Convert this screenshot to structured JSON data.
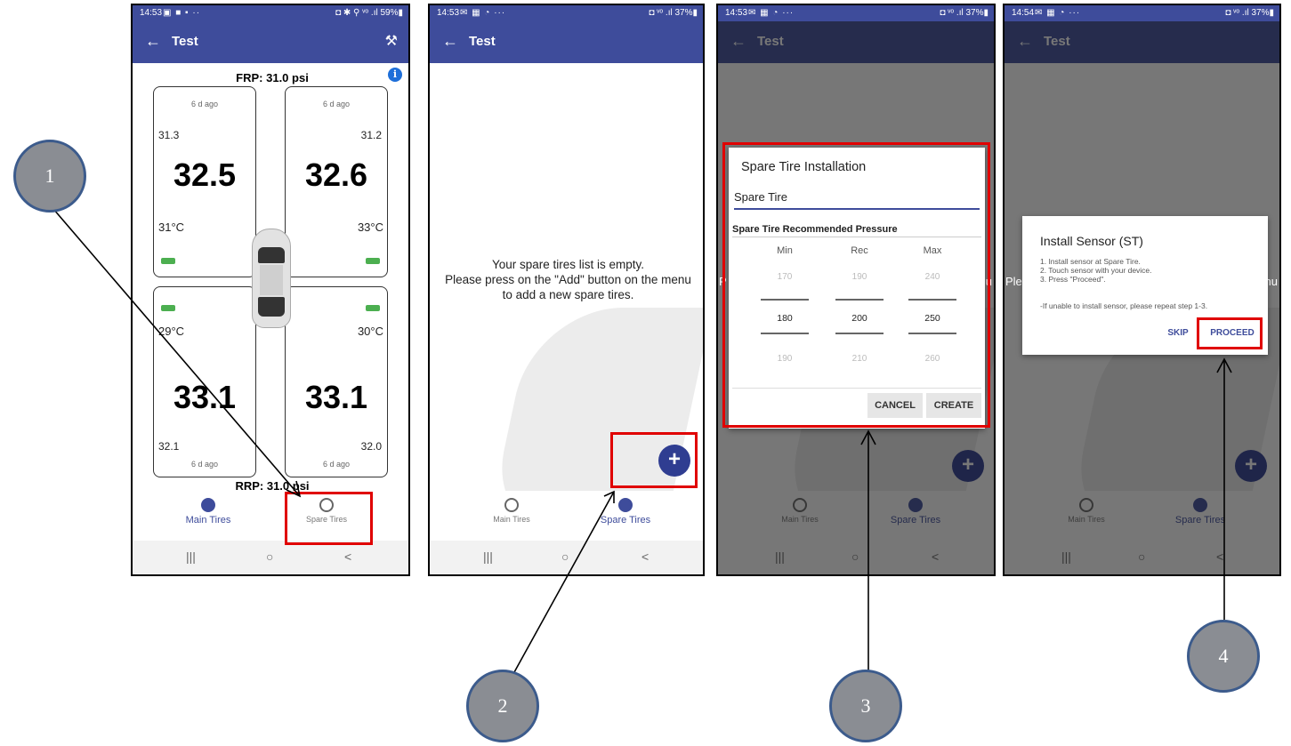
{
  "status": {
    "p1": {
      "time": "14:53",
      "icons": "▣ ■ ▪ ··",
      "right": "◘ ✱ ⚲ ᵛᵒ .ıl 59%▮"
    },
    "p2": {
      "time": "14:53",
      "icons": "✉ ▦ ◔ ···",
      "right": "◘ ᵛᵒ .ıl 37%▮"
    },
    "p3": {
      "time": "14:53",
      "icons": "✉ ▦ ◔ ···",
      "right": "◘ ᵛᵒ .ıl 37%▮"
    },
    "p4": {
      "time": "14:54",
      "icons": "✉ ▦ ◔ ···",
      "right": "◘ ᵛᵒ .ıl 37%▮"
    }
  },
  "appbar": {
    "back": "←",
    "title": "Test",
    "tool_icon": "wrench-icon",
    "tool_glyph": "⚒"
  },
  "main": {
    "frp": "FRP: 31.0 psi",
    "rrp": "RRP: 31.0 psi",
    "info_glyph": "i",
    "tires": {
      "fl": {
        "ago": "6 d ago",
        "cold": "31.3",
        "pressure": "32.5",
        "temp": "31°C"
      },
      "fr": {
        "ago": "6 d ago",
        "cold": "31.2",
        "pressure": "32.6",
        "temp": "33°C"
      },
      "rl": {
        "ago": "6 d ago",
        "cold": "32.1",
        "pressure": "33.1",
        "temp": "29°C"
      },
      "rr": {
        "ago": "6 d ago",
        "cold": "32.0",
        "pressure": "33.1",
        "temp": "30°C"
      }
    }
  },
  "bottom_nav": {
    "main_tires": "Main Tires",
    "spare_tires": "Spare Tires"
  },
  "system_nav": {
    "recents": "|||",
    "home": "○",
    "back": "<"
  },
  "spare": {
    "empty_line1": "Your spare tires list is empty.",
    "empty_line2": "Please press on the \"Add\" button on the menu",
    "empty_line3": "to add a new spare tires.",
    "fab_glyph": "+"
  },
  "install_dialog": {
    "title": "Spare Tire Installation",
    "name_value": "Spare Tire",
    "section": "Spare Tire Recommended Pressure",
    "headers": {
      "min": "Min",
      "rec": "Rec",
      "max": "Max"
    },
    "row_above": {
      "min": "170",
      "rec": "190",
      "max": "240"
    },
    "row_selected": {
      "min": "180",
      "rec": "200",
      "max": "250"
    },
    "row_below": {
      "min": "190",
      "rec": "210",
      "max": "260"
    },
    "cancel": "CANCEL",
    "create": "CREATE"
  },
  "behind_text": {
    "p3_left": "P",
    "p3_right": "u",
    "p4_left": "Ple",
    "p4_right": "nu"
  },
  "sensor_dialog": {
    "title": "Install Sensor (ST)",
    "step1": "1. Install sensor at Spare Tire.",
    "step2": "2. Touch sensor with your device.",
    "step3": "3. Press \"Proceed\".",
    "note": "-If unable to install sensor, please repeat step 1-3.",
    "skip": "SKIP",
    "proceed": "PROCEED"
  },
  "callouts": {
    "c1": "1",
    "c2": "2",
    "c3": "3",
    "c4": "4"
  },
  "colors": {
    "appbar": "#3e4c9b",
    "highlight": "#e00000",
    "callout": "#8a8d93",
    "battery": "#4caf50"
  }
}
